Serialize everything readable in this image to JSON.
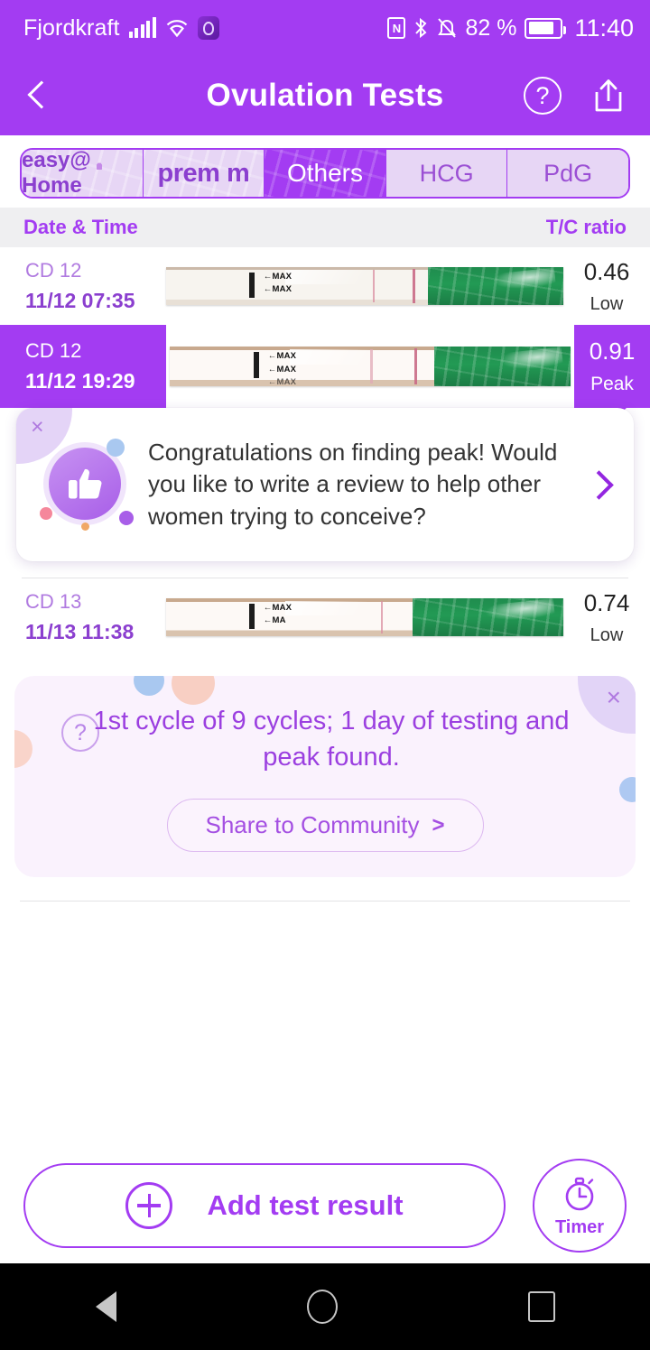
{
  "status_bar": {
    "carrier": "Fjordkraft",
    "battery_percent": "82 %",
    "clock": "11:40",
    "icons": [
      "signal-bars-icon",
      "wifi-icon",
      "app-badge-icon",
      "nfc-icon",
      "bluetooth-icon",
      "mute-icon",
      "battery-icon"
    ]
  },
  "header": {
    "title": "Ovulation Tests",
    "back_icon": "chevron-left-icon",
    "help_icon": "question-circle-icon",
    "help_label": "?",
    "share_icon": "share-icon"
  },
  "tabs": {
    "items": [
      {
        "id": "easy-home",
        "label": "easy@ Home",
        "selected": false
      },
      {
        "id": "premom",
        "label": "prem m",
        "selected": false
      },
      {
        "id": "others",
        "label": "Others",
        "selected": true
      },
      {
        "id": "hcg",
        "label": "HCG",
        "selected": false
      },
      {
        "id": "pdg",
        "label": "PdG",
        "selected": false
      }
    ]
  },
  "table": {
    "col_date": "Date & Time",
    "col_ratio": "T/C ratio",
    "rows": [
      {
        "cd": "CD 12",
        "datetime": "11/12  07:35",
        "ratio": "0.46",
        "level": "Low",
        "peak": false,
        "strip_labels": [
          "MAX",
          "MAX"
        ]
      },
      {
        "cd": "CD 12",
        "datetime": "11/12  19:29",
        "ratio": "0.91",
        "level": "Peak",
        "peak": true,
        "strip_labels": [
          "MAX",
          "MAX",
          "MAX"
        ]
      },
      {
        "cd": "CD 13",
        "datetime": "11/13  11:38",
        "ratio": "0.74",
        "level": "Low",
        "peak": false,
        "strip_labels": [
          "MAX",
          "MA"
        ]
      }
    ]
  },
  "review_card": {
    "close_label": "×",
    "icon": "thumbs-up-icon",
    "message": "Congratulations on finding peak! Would you like to write a review to help other women trying to conceive?",
    "chevron_icon": "chevron-right-icon"
  },
  "summary_card": {
    "help_label": "?",
    "text": "1st cycle of 9 cycles; 1 day of testing and peak found.",
    "share_button": "Share to Community",
    "share_button_arrow": ">",
    "close_label": "×"
  },
  "action_bar": {
    "add_label": "Add test result",
    "add_icon": "plus-circle-icon",
    "timer_label": "Timer",
    "timer_icon": "stopwatch-icon"
  },
  "nav_bar": {
    "back": "back-triangle-icon",
    "home": "home-circle-icon",
    "recents": "recents-square-icon"
  },
  "colors": {
    "brand_purple": "#a33cf2",
    "light_purple": "#e7d6f5",
    "text_purple": "#8b3fcf",
    "card_bg": "#faf2fd",
    "strip_green": "#229a54"
  }
}
